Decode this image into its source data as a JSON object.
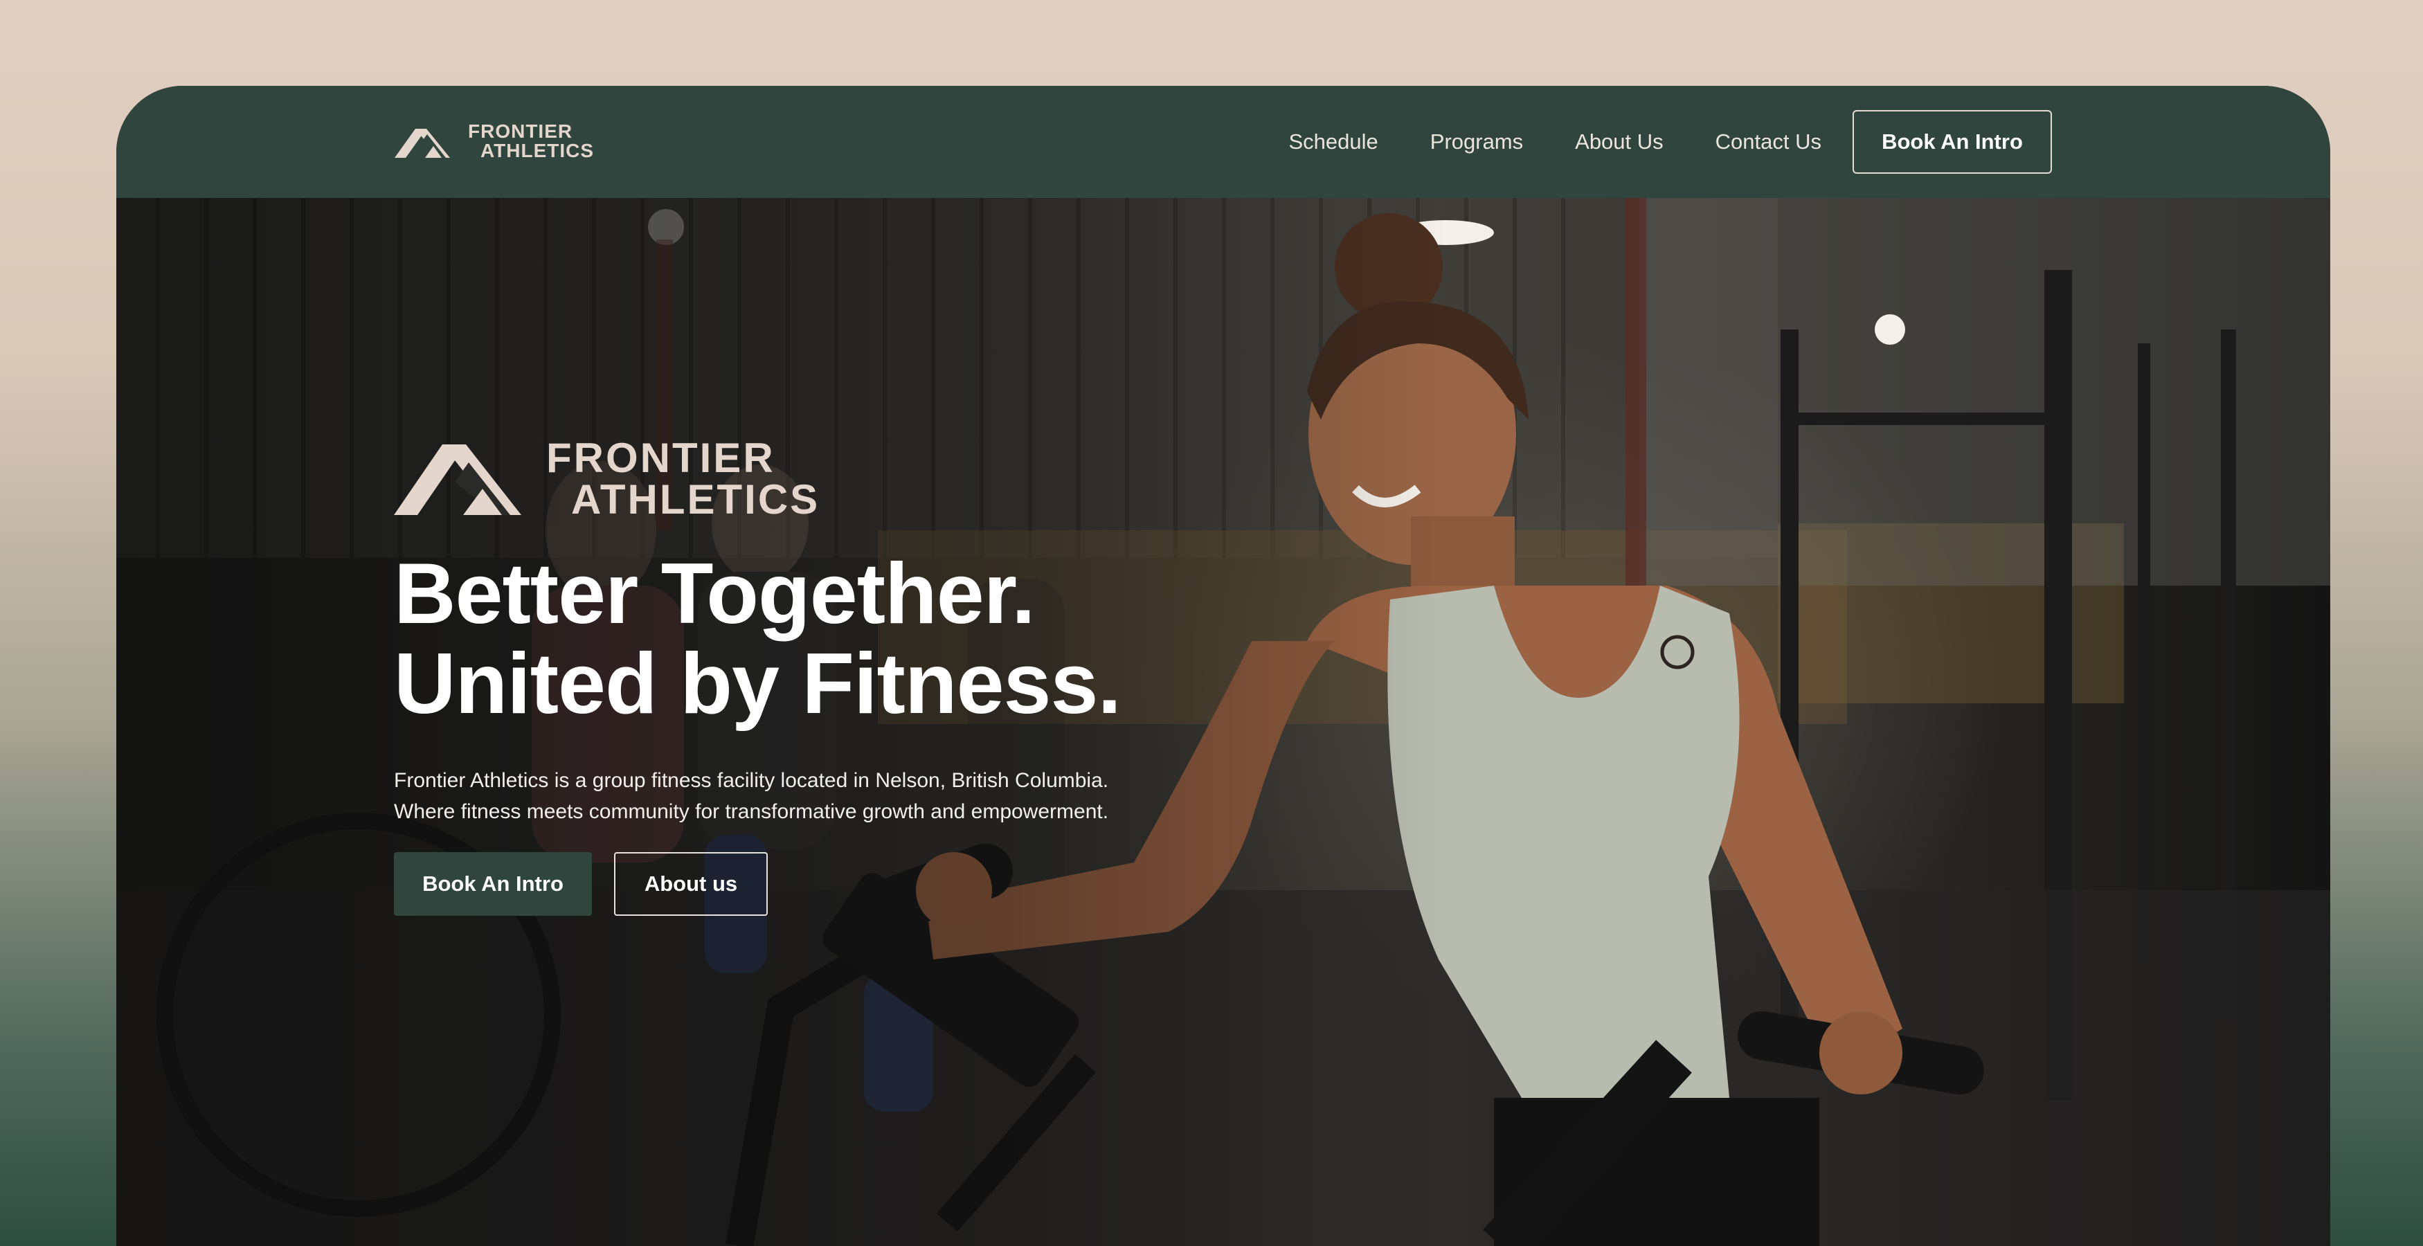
{
  "brand": {
    "name_line1": "FRONTIER",
    "name_line2": "ATHLETICS",
    "logo_icon": "mountain-chevron-icon"
  },
  "nav": {
    "links": [
      {
        "label": "Schedule"
      },
      {
        "label": "Programs"
      },
      {
        "label": "About Us"
      },
      {
        "label": "Contact Us"
      }
    ],
    "cta_label": "Book An Intro"
  },
  "hero": {
    "headline_line1": "Better Together.",
    "headline_line2": "United by Fitness.",
    "description_line1": "Frontier Athletics is a group fitness facility located in Nelson, British Columbia.",
    "description_line2": "Where fitness meets community for transformative growth and empowerment.",
    "primary_button": "Book An Intro",
    "secondary_button": "About us"
  },
  "colors": {
    "brand_green": "#30453d",
    "logo_beige": "#e4d6cc",
    "background_top": "#e1cfc1",
    "background_bottom": "#2e4d41"
  }
}
